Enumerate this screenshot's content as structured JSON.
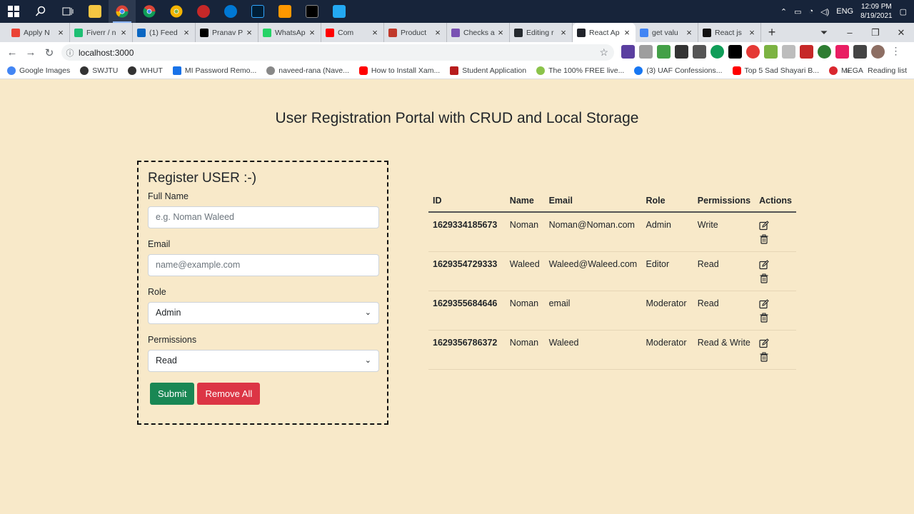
{
  "taskbar": {
    "time": "12:09 PM",
    "date": "8/19/2021",
    "lang": "ENG"
  },
  "tabs": [
    {
      "label": "Apply N",
      "color": "#ea4335"
    },
    {
      "label": "Fiverr / n",
      "color": "#1dbf73"
    },
    {
      "label": "(1) Feed",
      "color": "#0a66c2"
    },
    {
      "label": "Pranav P",
      "color": "#000000"
    },
    {
      "label": "WhatsAp",
      "color": "#25d366"
    },
    {
      "label": "Com",
      "color": "#ff0000"
    },
    {
      "label": "Product",
      "color": "#c0392b"
    },
    {
      "label": "Checks a",
      "color": "#7952b3"
    },
    {
      "label": "Editing r",
      "color": "#24292e"
    },
    {
      "label": "React Ap",
      "color": "#20232a"
    },
    {
      "label": "get valu",
      "color": "#4285f4"
    },
    {
      "label": "React js",
      "color": "#111111"
    }
  ],
  "address": {
    "url": "localhost:3000"
  },
  "bookmarks": [
    {
      "label": "Google Images",
      "color": "#4285f4"
    },
    {
      "label": "SWJTU",
      "color": "#333333"
    },
    {
      "label": "WHUT",
      "color": "#333333"
    },
    {
      "label": "MI Password Remo...",
      "color": "#1a73e8"
    },
    {
      "label": "naveed-rana (Nave...",
      "color": "#888888"
    },
    {
      "label": "How to Install Xam...",
      "color": "#ff0000"
    },
    {
      "label": "Student Application",
      "color": "#b71c1c"
    },
    {
      "label": "The 100% FREE live...",
      "color": "#8bc34a"
    },
    {
      "label": "(3) UAF Confessions...",
      "color": "#1877f2"
    },
    {
      "label": "Top 5 Sad Shayari B...",
      "color": "#ff0000"
    },
    {
      "label": "MEGA",
      "color": "#d9272e"
    }
  ],
  "bookmarks_more": "»",
  "reading_list": "Reading list",
  "page": {
    "title": "User Registration Portal with CRUD and Local Storage"
  },
  "form": {
    "heading": "Register USER :-)",
    "fullname_label": "Full Name",
    "fullname_placeholder": "e.g. Noman Waleed",
    "email_label": "Email",
    "email_placeholder": "name@example.com",
    "role_label": "Role",
    "role_value": "Admin",
    "permissions_label": "Permissions",
    "permissions_value": "Read",
    "submit_label": "Submit",
    "remove_all_label": "Remove All"
  },
  "table": {
    "headers": [
      "ID",
      "Name",
      "Email",
      "Role",
      "Permissions",
      "Actions"
    ],
    "rows": [
      {
        "id": "1629334185673",
        "name": "Noman",
        "email": "Noman@Noman.com",
        "role": "Admin",
        "permissions": "Write"
      },
      {
        "id": "1629354729333",
        "name": "Waleed",
        "email": "Waleed@Waleed.com",
        "role": "Editor",
        "permissions": "Read"
      },
      {
        "id": "1629355684646",
        "name": "Noman",
        "email": "email",
        "role": "Moderator",
        "permissions": "Read"
      },
      {
        "id": "1629356786372",
        "name": "Noman",
        "email": "Waleed",
        "role": "Moderator",
        "permissions": "Read & Write"
      }
    ]
  }
}
